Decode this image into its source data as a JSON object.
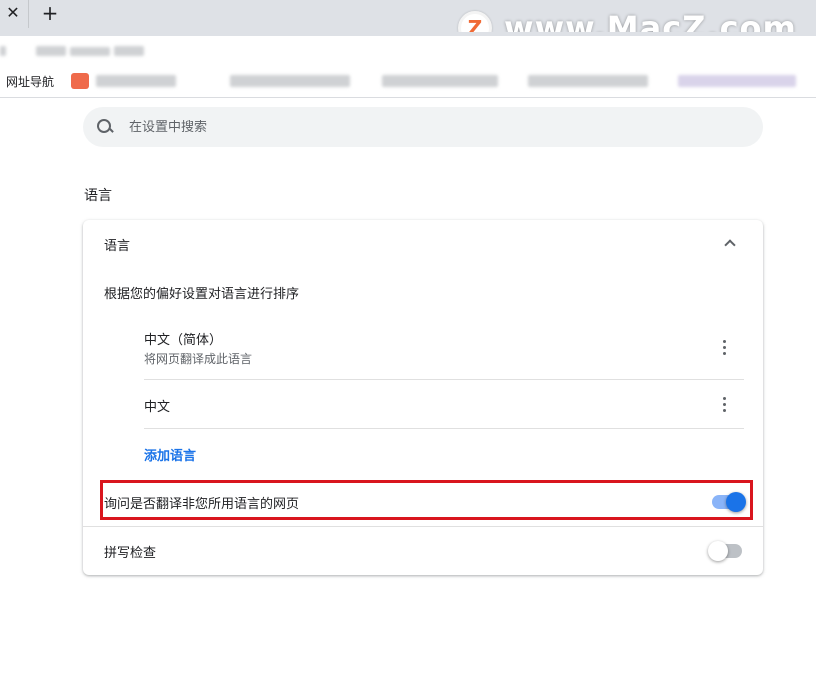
{
  "browser": {
    "close_tab_symbol": "✕",
    "new_tab_symbol": "+",
    "bookmarks_label": "网址导航"
  },
  "watermark": {
    "logo_letter": "Z",
    "text": "www.MacZ.com"
  },
  "search": {
    "placeholder": "在设置中搜索"
  },
  "section": {
    "title": "语言"
  },
  "language_card": {
    "header": "语言",
    "order_description": "根据您的偏好设置对语言进行排序",
    "languages": [
      {
        "name": "中文（简体）",
        "subtitle": "将网页翻译成此语言"
      },
      {
        "name": "中文",
        "subtitle": ""
      }
    ],
    "add_language": "添加语言",
    "translate_prompt": {
      "label": "询问是否翻译非您所用语言的网页",
      "enabled": true
    },
    "spell_check": {
      "label": "拼写检查",
      "enabled": false
    }
  },
  "colors": {
    "accent": "#1a73e8",
    "highlight_border": "#d9161e",
    "chrome_background": "#dee1e6"
  }
}
